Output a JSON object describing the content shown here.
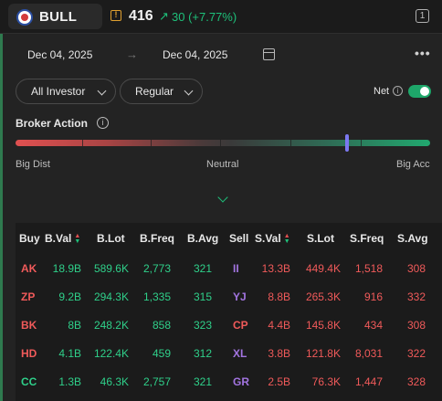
{
  "header": {
    "symbol": "BULL",
    "warning_mark": "!",
    "price": "416",
    "change_arrow": "↗",
    "change": "30 (+7.77%)",
    "window_badge": "1"
  },
  "dates": {
    "from": "Dec 04, 2025",
    "separator": "→",
    "to": "Dec 04, 2025"
  },
  "more_menu": "•••",
  "filters": {
    "investor": "All Investor",
    "market": "Regular",
    "net_label": "Net",
    "net_info": "i",
    "net_enabled": true
  },
  "broker_action": {
    "title": "Broker Action",
    "info": "i",
    "left_label": "Big Dist",
    "center_label": "Neutral",
    "right_label": "Big Acc",
    "position_fraction": 0.8
  },
  "table": {
    "headers": [
      "Buy",
      "B.Val",
      "B.Lot",
      "B.Freq",
      "B.Avg",
      "Sell",
      "S.Val",
      "S.Lot",
      "S.Freq",
      "S.Avg"
    ],
    "rows": [
      {
        "buy": "AK",
        "b_val": "18.9B",
        "b_lot": "589.6K",
        "b_freq": "2,773",
        "b_avg": "321",
        "sell": "II",
        "s_val": "13.3B",
        "s_lot": "449.4K",
        "s_freq": "1,518",
        "s_avg": "308"
      },
      {
        "buy": "ZP",
        "b_val": "9.2B",
        "b_lot": "294.3K",
        "b_freq": "1,335",
        "b_avg": "315",
        "sell": "YJ",
        "s_val": "8.8B",
        "s_lot": "265.3K",
        "s_freq": "916",
        "s_avg": "332"
      },
      {
        "buy": "BK",
        "b_val": "8B",
        "b_lot": "248.2K",
        "b_freq": "858",
        "b_avg": "323",
        "sell": "CP",
        "s_val": "4.4B",
        "s_lot": "145.8K",
        "s_freq": "434",
        "s_avg": "308"
      },
      {
        "buy": "HD",
        "b_val": "4.1B",
        "b_lot": "122.4K",
        "b_freq": "459",
        "b_avg": "312",
        "sell": "XL",
        "s_val": "3.8B",
        "s_lot": "121.8K",
        "s_freq": "8,031",
        "s_avg": "322"
      },
      {
        "buy": "CC",
        "b_val": "1.3B",
        "b_lot": "46.3K",
        "b_freq": "2,757",
        "b_avg": "321",
        "sell": "GR",
        "s_val": "2.5B",
        "s_lot": "76.3K",
        "s_freq": "1,447",
        "s_avg": "328"
      }
    ],
    "buy_code_colors": {
      "AK": "#f05a5a",
      "ZP": "#f05a5a",
      "BK": "#f05a5a",
      "HD": "#f05a5a",
      "CC": "#2fd08a"
    },
    "sell_code_colors": {
      "II": "#a274e0",
      "YJ": "#a274e0",
      "CP": "#f05a5a",
      "XL": "#a274e0",
      "GR": "#a274e0"
    },
    "buy_value_color": "#2fd08a",
    "sell_value_color": "#f05a5a"
  }
}
